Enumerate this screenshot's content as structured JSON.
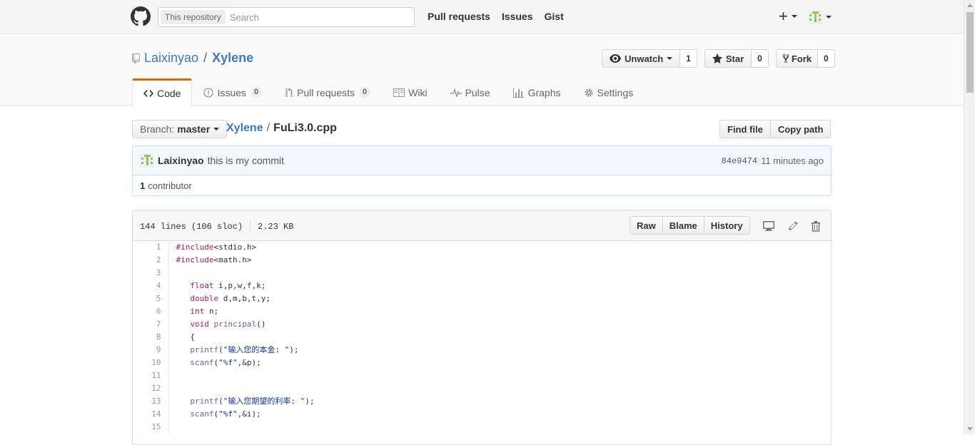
{
  "header": {
    "search_scope": "This repository",
    "search_placeholder": "Search",
    "nav": [
      "Pull requests",
      "Issues",
      "Gist"
    ]
  },
  "repo": {
    "owner": "Laixinyao",
    "name": "Xylene",
    "separator": "/",
    "watch_label": "Unwatch",
    "watch_count": "1",
    "star_label": "Star",
    "star_count": "0",
    "fork_label": "Fork",
    "fork_count": "0"
  },
  "tabs": [
    {
      "label": "Code",
      "icon": "code-icon",
      "selected": true
    },
    {
      "label": "Issues",
      "icon": "issue-icon",
      "count": "0"
    },
    {
      "label": "Pull requests",
      "icon": "pull-request-icon",
      "count": "0"
    },
    {
      "label": "Wiki",
      "icon": "book-icon"
    },
    {
      "label": "Pulse",
      "icon": "pulse-icon"
    },
    {
      "label": "Graphs",
      "icon": "graph-icon"
    },
    {
      "label": "Settings",
      "icon": "gear-icon"
    }
  ],
  "file_nav": {
    "branch_label": "Branch:",
    "branch_value": "master",
    "path_repo": "Xylene",
    "path_sep": "/",
    "path_file": "FuLi3.0.cpp",
    "find_file": "Find file",
    "copy_path": "Copy path"
  },
  "commit": {
    "author": "Laixinyao",
    "message": "this is my commit",
    "sha": "84e9474",
    "time": "11 minutes ago",
    "contributors_count": "1",
    "contributors_label": "contributor"
  },
  "file": {
    "lines_info": "144 lines (106 sloc)",
    "size": "2.23 KB",
    "raw": "Raw",
    "blame": "Blame",
    "history": "History",
    "code": [
      "#include<stdio.h>",
      "#include<math.h>",
      "",
      "   float i,p,w,f,k;",
      "   double d,m,b,t,y;",
      "   int n;",
      "   void principal()",
      "   {",
      "   printf(\"输入您的本金: \");",
      "   scanf(\"%f\",&p);",
      "",
      "",
      "   printf(\"输入您期望的利率: \");",
      "   scanf(\"%f\",&i);",
      ""
    ]
  },
  "colors": {
    "link": "#4078c0",
    "tab_accent": "#d26911",
    "commit_bg": "#f2f9fc",
    "avatar_green": "#8cc665"
  }
}
